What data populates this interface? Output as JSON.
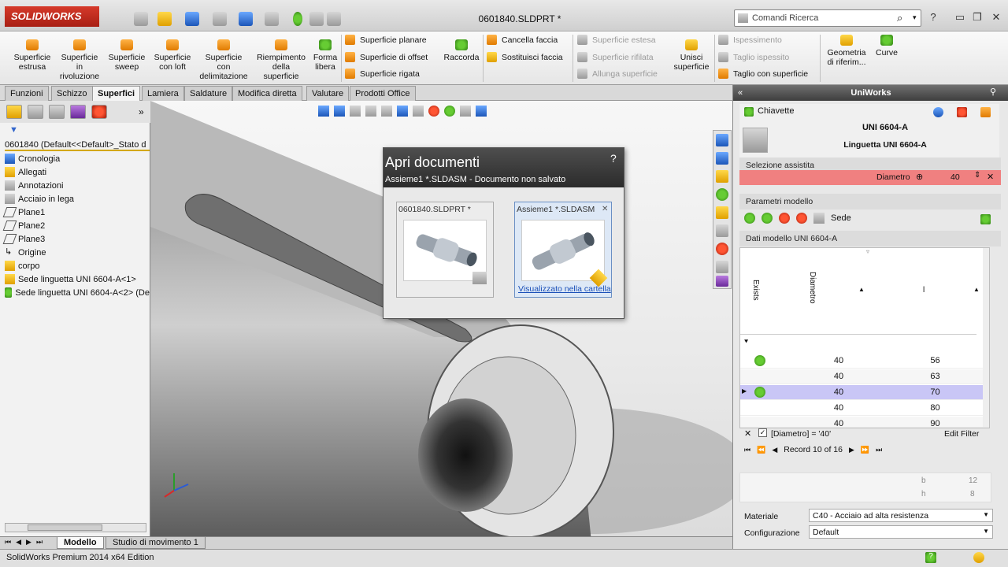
{
  "app": {
    "logo_text": "SOLIDWORKS",
    "document_title": "0601840.SLDPRT *",
    "search_placeholder": "Comandi Ricerca"
  },
  "ribbon": {
    "big_commands": [
      {
        "label": "Superficie\nestrusa"
      },
      {
        "label": "Superficie\nin\nrivoluzione"
      },
      {
        "label": "Superficie\nsweep"
      },
      {
        "label": "Superficie\ncon loft"
      },
      {
        "label": "Superficie\ncon\ndelimitazione"
      },
      {
        "label": "Riempimento\ndella\nsuperficie"
      },
      {
        "label": "Forma\nlibera"
      }
    ],
    "col1": [
      "Superficie planare",
      "Superficie di offset",
      "Superficie rigata"
    ],
    "raccorda": "Raccorda",
    "col2": [
      "Cancella faccia",
      "Sostituisci faccia"
    ],
    "col3_disabled": [
      "Superficie estesa",
      "Superficie rifilata",
      "Allunga superficie"
    ],
    "unisci": "Unisci\nsuperficie",
    "col4": [
      "Ispessimento",
      "Taglio ispessito",
      "Taglio con superficie"
    ],
    "geometria": "Geometria\ndi riferim...",
    "curve": "Curve"
  },
  "tabs": [
    "Funzioni",
    "Schizzo",
    "Superfici",
    "Lamiera",
    "Saldature",
    "Modifica diretta",
    "Valutare",
    "Prodotti Office"
  ],
  "active_tab": "Superfici",
  "feature_tree": {
    "root": "0601840  (Default<<Default>_Stato d",
    "items": [
      "Cronologia",
      "Allegati",
      "Annotazioni",
      "Acciaio in lega",
      "Plane1",
      "Plane2",
      "Plane3",
      "Origine",
      "corpo",
      "Sede linguetta UNI 6604-A<1>",
      "Sede linguetta UNI 6604-A<2> (De"
    ]
  },
  "bottom_tabs": [
    "Modello",
    "Studio di movimento 1"
  ],
  "status_text": "SolidWorks Premium 2014 x64 Edition",
  "dialog": {
    "title": "Apri documenti",
    "help": "?",
    "subtitle": "Assieme1 *.SLDASM - Documento non salvato",
    "thumb1_name": "0601840.SLDPRT *",
    "thumb2_name": "Assieme1 *.SLDASM",
    "thumb2_link": "Visualizzato nella cartella"
  },
  "uniworks": {
    "title": "UniWorks",
    "breadcrumb": "Chiavette",
    "part_code": "UNI 6604-A",
    "part_desc": "Linguetta UNI 6604-A",
    "sel_assistita": "Selezione assistita",
    "diametro_label": "Diametro",
    "diametro_value": "40",
    "parametri": "Parametri modello",
    "sede": "Sede",
    "dati_modello": "Dati modello UNI 6604-A",
    "col_exists": "Exists",
    "col_diametro": "Diametro",
    "col_l": "l",
    "rows": [
      {
        "d": "40",
        "l": "56",
        "status": "ok"
      },
      {
        "d": "40",
        "l": "63",
        "status": ""
      },
      {
        "d": "40",
        "l": "70",
        "status": "ok"
      },
      {
        "d": "40",
        "l": "80",
        "status": ""
      },
      {
        "d": "40",
        "l": "90",
        "status": ""
      }
    ],
    "filter_text": "[Diametro] = '40'",
    "edit_filter": "Edit Filter",
    "record_text": "Record 10 of 16",
    "b_label": "b",
    "b_value": "12",
    "h_label": "h",
    "h_value": "8",
    "materiale_label": "Materiale",
    "materiale_value": "C40 - Acciaio ad alta resistenza",
    "config_label": "Configurazione",
    "config_value": "Default"
  },
  "colors": {
    "accent": "#c9c6f6",
    "highlight_row": "#f08080",
    "brand_red": "#d63a2a"
  }
}
